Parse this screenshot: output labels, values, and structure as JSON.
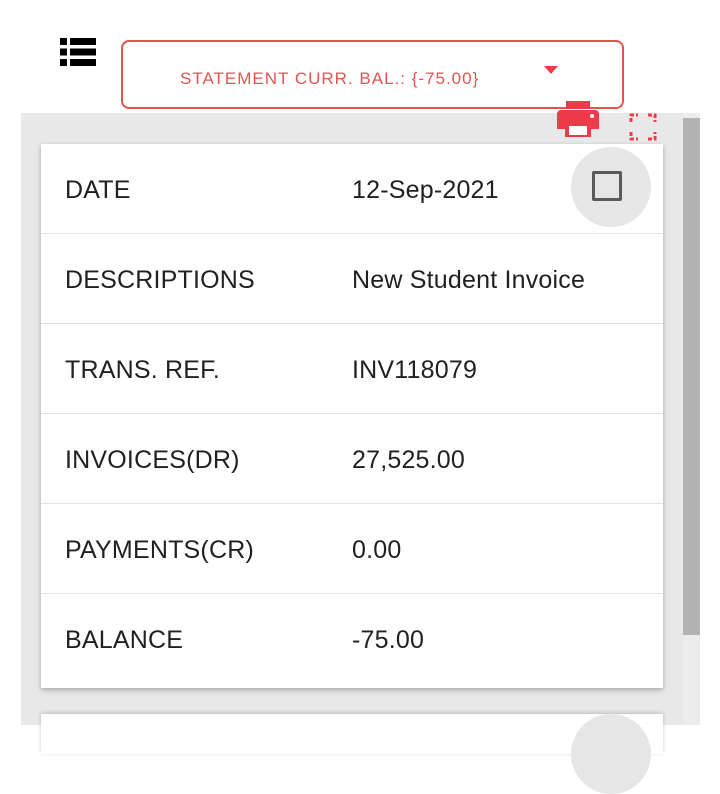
{
  "toolbar": {
    "list_icon": "list-icon",
    "statement_select": {
      "label": "STATEMENT CURR. BAL.: {-75.00}",
      "caret_icon": "caret-down-icon"
    },
    "print_icon": "print-icon",
    "fullscreen_icon": "fullscreen-icon",
    "accent_color": "#e0564f",
    "icon_color": "#ef3a4a"
  },
  "record": {
    "rows": [
      {
        "label": "DATE",
        "value": "12-Sep-2021"
      },
      {
        "label": "DESCRIPTIONS",
        "value": "New Student Invoice"
      },
      {
        "label": "TRANS. REF.",
        "value": "INV118079"
      },
      {
        "label": "INVOICES(DR)",
        "value": "27,525.00"
      },
      {
        "label": "PAYMENTS(CR)",
        "value": "0.00"
      },
      {
        "label": "BALANCE",
        "value": "-75.00"
      }
    ],
    "select_checkbox": {
      "checked": false
    }
  }
}
